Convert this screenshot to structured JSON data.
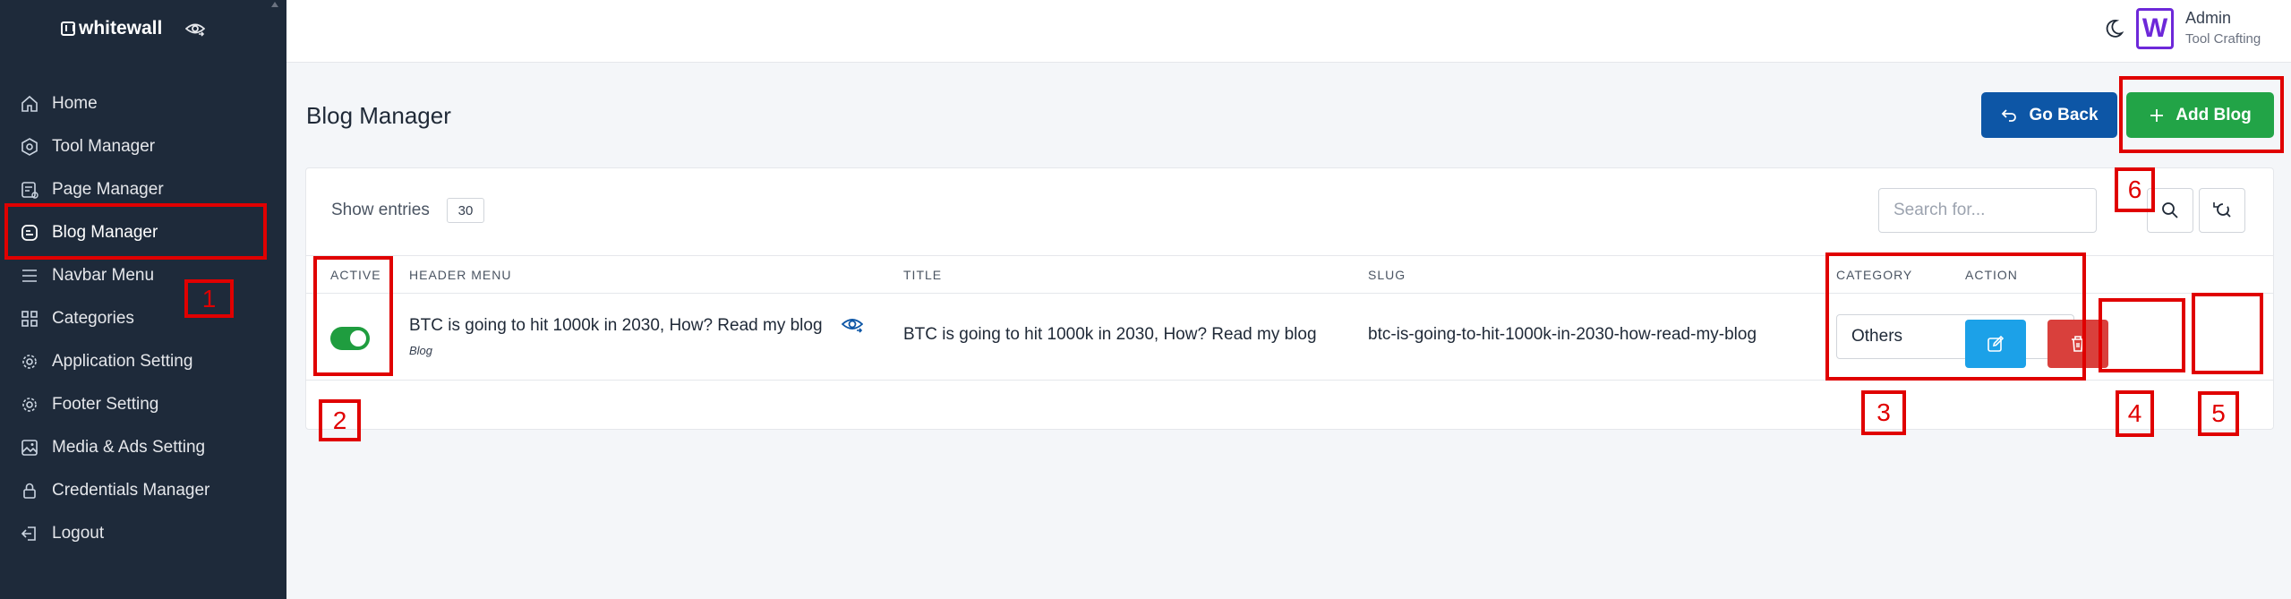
{
  "brand": {
    "name": "whitewall"
  },
  "sidebar": {
    "items": [
      {
        "label": "Home",
        "icon": "home-icon"
      },
      {
        "label": "Tool Manager",
        "icon": "hexagon-gear-icon"
      },
      {
        "label": "Page Manager",
        "icon": "page-icon"
      },
      {
        "label": "Blog Manager",
        "icon": "blog-icon",
        "active": true
      },
      {
        "label": "Navbar Menu",
        "icon": "menu-icon"
      },
      {
        "label": "Categories",
        "icon": "grid-icon"
      },
      {
        "label": "Application Setting",
        "icon": "gear-icon"
      },
      {
        "label": "Footer Setting",
        "icon": "gear-icon"
      },
      {
        "label": "Media & Ads Setting",
        "icon": "image-icon"
      },
      {
        "label": "Credentials Manager",
        "icon": "lock-icon"
      },
      {
        "label": "Logout",
        "icon": "logout-icon"
      }
    ]
  },
  "header": {
    "avatar_letter": "W",
    "user_name": "Admin",
    "user_role": "Tool Crafting"
  },
  "page": {
    "title": "Blog Manager",
    "back_label": "Go Back",
    "add_label": "Add Blog"
  },
  "table": {
    "show_entries_label": "Show entries",
    "entries_value": "30",
    "search_placeholder": "Search for...",
    "columns": {
      "active": "ACTIVE",
      "header_menu": "HEADER MENU",
      "title": "TITLE",
      "slug": "SLUG",
      "category": "CATEGORY",
      "action": "ACTION"
    },
    "rows": [
      {
        "active": true,
        "header_menu": "BTC is going to hit 1000k in 2030, How? Read my blog",
        "header_menu_sub": "Blog",
        "title": "BTC is going to hit 1000k in 2030, How? Read my blog",
        "slug": "btc-is-going-to-hit-1000k-in-2030-how-read-my-blog",
        "category": "Others"
      }
    ]
  },
  "annotations": [
    "1",
    "2",
    "3",
    "4",
    "5",
    "6"
  ],
  "colors": {
    "sidebar_bg": "#1e2a3a",
    "primary_blue": "#0d56a6",
    "success_green": "#22a447",
    "edit_blue": "#1ca1e8",
    "delete_red": "#d9403c",
    "annotation_red": "#e00000"
  }
}
